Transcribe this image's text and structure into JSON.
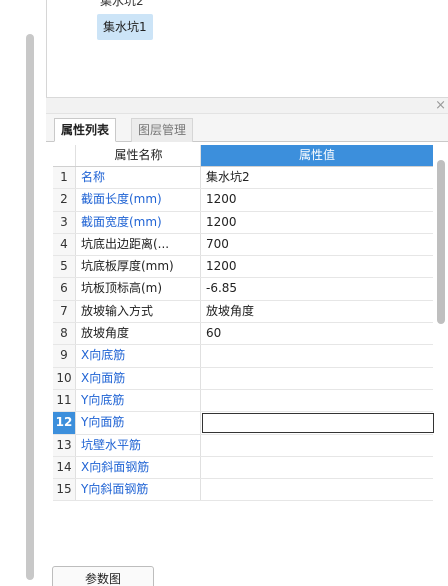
{
  "tree": {
    "prev_item": "集水坑2",
    "selected_item": "集水坑1"
  },
  "panel": {
    "close_glyph": "×"
  },
  "tabs": [
    {
      "label": "属性列表"
    },
    {
      "label": "图层管理"
    }
  ],
  "grid": {
    "header_name": "属性名称",
    "header_value": "属性值",
    "rows": [
      {
        "num": "1",
        "name": "名称",
        "value": "集水坑2",
        "blue": true
      },
      {
        "num": "2",
        "name": "截面长度(mm)",
        "value": "1200",
        "blue": true
      },
      {
        "num": "3",
        "name": "截面宽度(mm)",
        "value": "1200",
        "blue": true
      },
      {
        "num": "4",
        "name": "坑底出边距离(...",
        "value": "700",
        "blue": false
      },
      {
        "num": "5",
        "name": "坑底板厚度(mm)",
        "value": "1200",
        "blue": false
      },
      {
        "num": "6",
        "name": "坑板顶标高(m)",
        "value": "-6.85",
        "blue": false
      },
      {
        "num": "7",
        "name": "放坡输入方式",
        "value": "放坡角度",
        "blue": false
      },
      {
        "num": "8",
        "name": "放坡角度",
        "value": "60",
        "blue": false
      },
      {
        "num": "9",
        "name": "X向底筋",
        "value": "",
        "blue": true
      },
      {
        "num": "10",
        "name": "X向面筋",
        "value": "",
        "blue": true
      },
      {
        "num": "11",
        "name": "Y向底筋",
        "value": "",
        "blue": true
      },
      {
        "num": "12",
        "name": "Y向面筋",
        "value": "",
        "blue": true,
        "active": true
      },
      {
        "num": "13",
        "name": "坑壁水平筋",
        "value": "",
        "blue": true
      },
      {
        "num": "14",
        "name": "X向斜面钢筋",
        "value": "",
        "blue": true
      },
      {
        "num": "15",
        "name": "Y向斜面钢筋",
        "value": "",
        "blue": true
      }
    ]
  },
  "footer": {
    "button_label": "参数图"
  },
  "colors": {
    "accent": "#3c8fdc",
    "link_text": "#1f63d4",
    "selection": "#cce4f7"
  }
}
